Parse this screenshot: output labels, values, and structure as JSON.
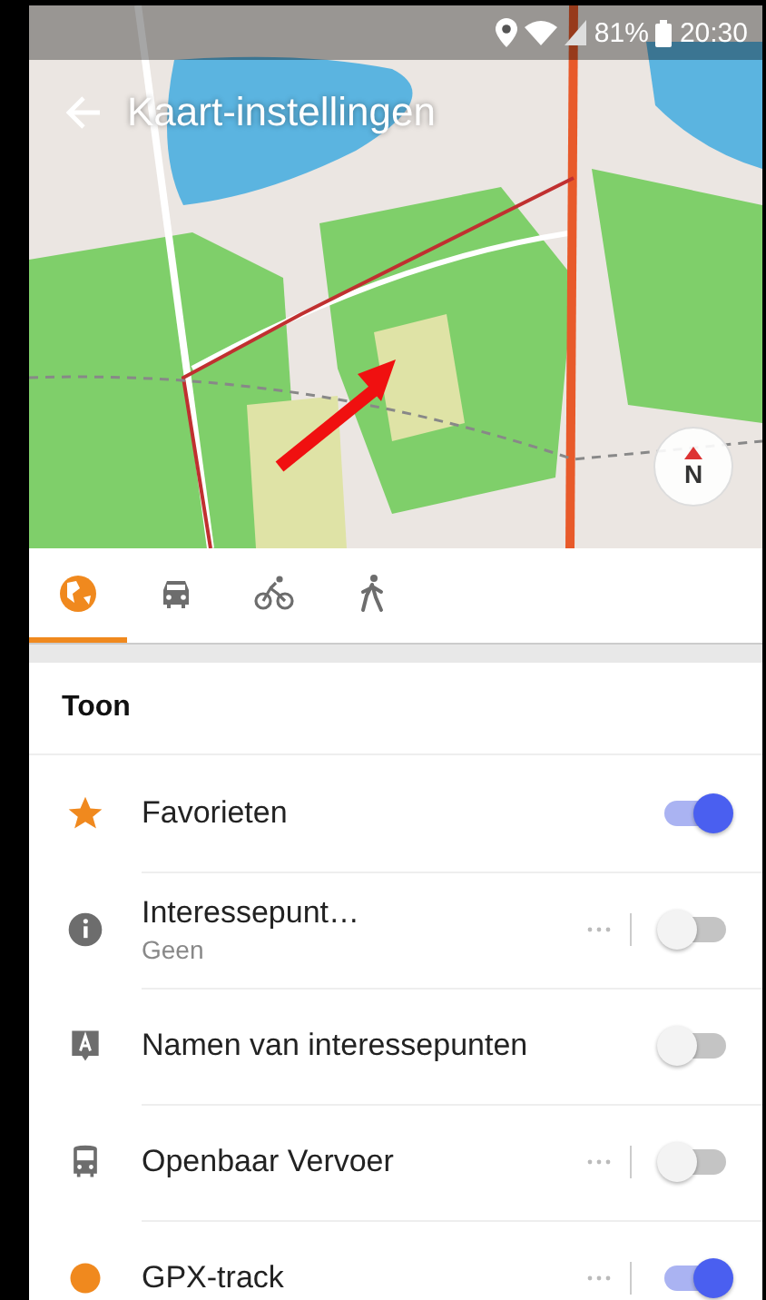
{
  "status_bar": {
    "battery": "81%",
    "time": "20:30"
  },
  "header": {
    "title": "Kaart-instellingen"
  },
  "map": {
    "compass_label": "N"
  },
  "tabs": [
    {
      "selected": true
    },
    {
      "selected": false
    },
    {
      "selected": false
    },
    {
      "selected": false
    }
  ],
  "section": {
    "title": "Toon"
  },
  "rows": [
    {
      "label": "Favorieten",
      "on": true,
      "more": false
    },
    {
      "label": "Interessepunt…",
      "subtitle": "Geen",
      "on": false,
      "more": true
    },
    {
      "label": "Namen van interessepunten",
      "on": false,
      "more": false
    },
    {
      "label": "Openbaar Vervoer",
      "on": false,
      "more": true
    },
    {
      "label": "GPX-track",
      "on": true,
      "more": true
    }
  ]
}
